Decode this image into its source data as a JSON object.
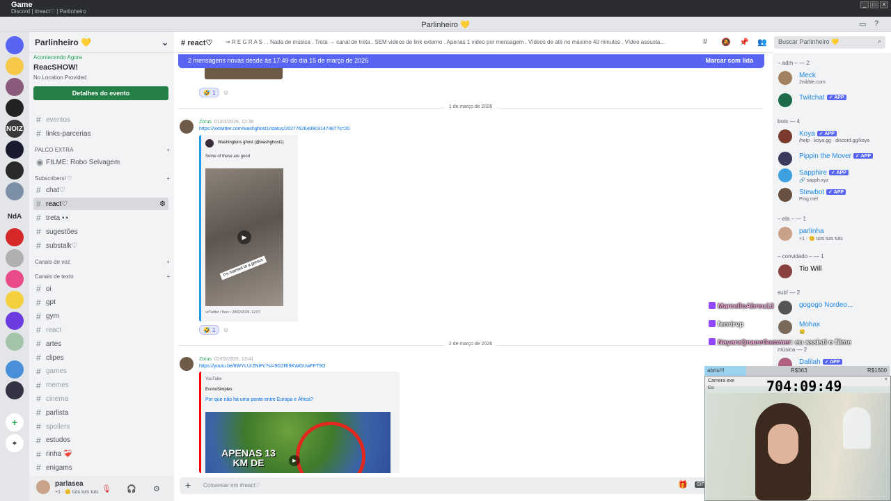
{
  "os": {
    "app_name": "Game",
    "window_subtitle": "Discord | #react♡ | Parlinheiro"
  },
  "titlebar": {
    "server": "Parlinheiro 💛"
  },
  "server_rail": [
    {
      "label": "",
      "color": "#5865f2",
      "icon": "discord-home-icon"
    },
    {
      "label": "",
      "color": "#f7c948"
    },
    {
      "label": "",
      "color": "#8a5a7a"
    },
    {
      "label": "",
      "color": "#222222"
    },
    {
      "label": "NOIZ",
      "color": "#3a3a3a"
    },
    {
      "label": "",
      "color": "#1a1a2e"
    },
    {
      "label": "",
      "color": "#2a2a2a"
    },
    {
      "label": "",
      "color": "#7b8fa6"
    },
    {
      "label": "NdA",
      "color": "#e3e5e8"
    },
    {
      "label": "",
      "color": "#d62828"
    },
    {
      "label": "",
      "color": "#b0b0b0"
    },
    {
      "label": "",
      "color": "#e84a8a"
    },
    {
      "label": "",
      "color": "#f4d03f"
    },
    {
      "label": "",
      "color": "#6c3ce0"
    },
    {
      "label": "",
      "color": "#a3c4a8"
    },
    {
      "label": "",
      "color": "#4a90d9"
    },
    {
      "label": "",
      "color": "#333344"
    }
  ],
  "sidebar": {
    "guild_name": "Parlinheiro 💛",
    "event": {
      "live_label": "Acontecendo Agora",
      "title": "ReacSHOW!",
      "location": "No Location Provided",
      "button": "Detalhes do evento"
    },
    "channels_top": [
      {
        "name": "eventos",
        "muted": true
      },
      {
        "name": "links-parcerias",
        "muted": false
      }
    ],
    "cat_palco": "PALCO EXTRA",
    "stage_channel": "FILME: Robo Selvagem",
    "cat_subs": "Subscribers! ♡",
    "sub_channels": [
      {
        "name": "chat♡",
        "active": false
      },
      {
        "name": "react♡",
        "active": true
      },
      {
        "name": "treta 👀",
        "active": false
      },
      {
        "name": "sugestões",
        "active": false
      },
      {
        "name": "substalk♡",
        "active": false
      }
    ],
    "cat_voz": "Canais de voz",
    "cat_texto": "Canais de texto",
    "text_channels": [
      {
        "name": "oi",
        "muted": false
      },
      {
        "name": "gpt",
        "muted": false
      },
      {
        "name": "gym",
        "muted": false
      },
      {
        "name": "react",
        "muted": true
      },
      {
        "name": "artes",
        "muted": false
      },
      {
        "name": "clipes",
        "muted": false
      },
      {
        "name": "games",
        "muted": true
      },
      {
        "name": "memes",
        "muted": true
      },
      {
        "name": "cinema",
        "muted": true
      },
      {
        "name": "parlista",
        "muted": false
      },
      {
        "name": "spoilers",
        "muted": true
      },
      {
        "name": "estudos",
        "muted": false
      },
      {
        "name": "rinha ❤️‍🩹",
        "muted": false
      },
      {
        "name": "enigams",
        "muted": false
      }
    ],
    "user": {
      "name": "parlasea",
      "status": "+1 · 😊 tuts tuts tuts"
    }
  },
  "chat": {
    "channel": "react♡",
    "topic": "⇒ R E G R A S . . Nada de música . Treta → canal de treta . SEM videos de link externo . Apenas 1 video por mensagem . Vídeos de até no máximo 40 minutos . Vídeo assusta...",
    "search_placeholder": "Buscar Parlinheiro 💛",
    "banner": "2 mensagens novas desde às 17:49 do dia 15 de março de 2026",
    "banner_action": "Marcar com lida",
    "reaction_emoji": "🤣",
    "reaction_count": "1",
    "divider1": "1 de março de 2026",
    "divider2": "2 de março de 2026",
    "msg1": {
      "author": "Zorus",
      "time": "01/03/2026, 12:38",
      "link": "https://vxtwitter.com/washghost1/status/2027762640903147487?s=20",
      "embed_author": "Washingtons ghost (@washghost1)",
      "embed_text": "Some of these are good",
      "caption": "I'm married to a genius",
      "footer": "vxTwitter / fixvx  •  28/02/2026, 12:07"
    },
    "msg2": {
      "author": "Zorus",
      "time": "02/03/2026, 13:41",
      "link": "https://youtu.be/8WYLUrZNiPc?si=9G2RI9KWGUwFFT9O",
      "provider": "YouTube",
      "channel": "EconoSimples",
      "title": "Por que não há uma ponte entre Europa e África?",
      "thumb_text": "APENAS 13 KM DE"
    },
    "composer_placeholder": "Conversar em #react♡"
  },
  "members": {
    "groups": [
      {
        "title": "– adm – — 2",
        "members": [
          {
            "name": "Meck",
            "status": "2nibble.com",
            "color": "#1e88e5",
            "app": false,
            "av": "#a08060"
          },
          {
            "name": "Twitchat",
            "status": "",
            "color": "#1e88e5",
            "app": true,
            "av": "#1e6b4a"
          }
        ]
      },
      {
        "title": "bots — 4",
        "members": [
          {
            "name": "Koya",
            "status": "/help · koya.gg · discord.gg/koya",
            "color": "#1e88e5",
            "app": true,
            "av": "#7a3b2e"
          },
          {
            "name": "Pippin the Mover",
            "status": "",
            "color": "#1e88e5",
            "app": true,
            "av": "#3a3a5c"
          },
          {
            "name": "Sapphire",
            "status": "🔗 sapph.xyz",
            "color": "#1e88e5",
            "app": true,
            "av": "#3aa0e0"
          },
          {
            "name": "Stewbot",
            "status": "Ping me!",
            "color": "#1e88e5",
            "app": true,
            "av": "#6a5040"
          }
        ]
      },
      {
        "title": "– ela – — 1",
        "members": [
          {
            "name": "parlinha",
            "status": "+1 · 😊 tuts tuts tuts",
            "color": "#1e88e5",
            "app": false,
            "av": "#c9a28a"
          }
        ]
      },
      {
        "title": "– convidado – — 1",
        "members": [
          {
            "name": "Tio Will",
            "status": "",
            "color": "#060607",
            "app": false,
            "av": "#8a4040"
          }
        ]
      },
      {
        "title": "sub! — 2",
        "members": [
          {
            "name": "gogogo Nordeo...",
            "status": "",
            "color": "#1e88e5",
            "app": false,
            "av": "#555"
          },
          {
            "name": "Mohax",
            "status": "😢",
            "color": "#1e88e5",
            "app": false,
            "av": "#7a6a5a"
          }
        ]
      },
      {
        "title": "música — 2",
        "members": [
          {
            "name": "Dalilah",
            "status": "",
            "color": "#1e88e5",
            "app": true,
            "av": "#b06080"
          }
        ]
      }
    ]
  },
  "overlay": {
    "twitch_chat": [
      {
        "user": "MarcelloAbreu13",
        "msg": "",
        "color": "#f4a6d7"
      },
      {
        "user": "fenrirvp",
        "msg": "",
        "color": "#ffffff"
      },
      {
        "user": "NayaraQnaoeGammer",
        "msg": ": eu assisti o filme",
        "color": "#f4a6d7"
      }
    ],
    "goal": {
      "left": "abriu!!!",
      "mid": "R$363",
      "right": "R$1600",
      "fraction": 0.227
    },
    "cam_title": "Camera exe",
    "cam_sub": "Elo",
    "timer": "704:09:49"
  }
}
